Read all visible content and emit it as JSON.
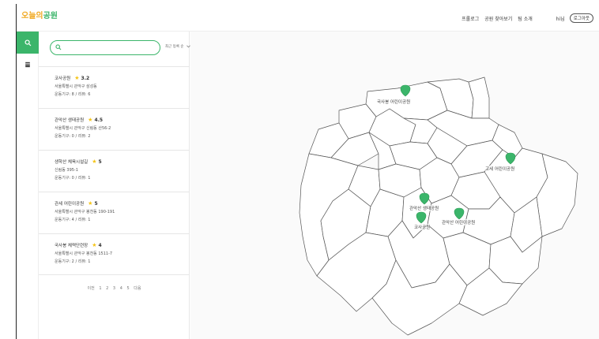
{
  "header": {
    "logo": {
      "part1": "오늘의",
      "part2": "공원"
    },
    "nav": [
      "프롤로그",
      "공원 찾아보기",
      "팀 소개"
    ],
    "user": "hi님",
    "logout": "로그아웃"
  },
  "sidebar": {
    "tabs": [
      {
        "name": "search",
        "icon": "search-icon",
        "active": true
      },
      {
        "name": "bookmark",
        "icon": "book-icon",
        "active": false
      }
    ]
  },
  "search": {
    "placeholder": "",
    "value": ""
  },
  "sort": {
    "label": "최근 등록 순"
  },
  "parks": [
    {
      "name": "코사공원",
      "rating": "3.2",
      "address": "서울특별시 관악구 삼성동",
      "stats": "운동기구: 8 / 리뷰: 6"
    },
    {
      "name": "관악산 생태공원",
      "rating": "4.5",
      "address": "서울특별시 관악구 신림동 산56-2",
      "stats": "운동기구: 0 / 리뷰: 2"
    },
    {
      "name": "생학산 체육시설길",
      "rating": "5",
      "address": "신림동 395-1",
      "stats": "운동기구: 0 / 리뷰: 1"
    },
    {
      "name": "관세 어린이공원",
      "rating": "5",
      "address": "서울특별시 관악구 봉천동 190-191",
      "stats": "운동기구: 4 / 리뷰: 1"
    },
    {
      "name": "국사봉 체력단련장",
      "rating": "4",
      "address": "서울특별시 관악구 봉천동 1511-7",
      "stats": "운동기구: 2 / 리뷰: 1"
    }
  ],
  "pagination": {
    "prev": "이전",
    "pages": [
      "1",
      "2",
      "3",
      "4",
      "5"
    ],
    "next": "다음"
  },
  "map": {
    "accent": "#3bb56a",
    "markers": [
      {
        "label": "국사봉 어린이공원"
      },
      {
        "label": "고세 어린이공원"
      },
      {
        "label": "관악산 생태공원"
      },
      {
        "label": "코사공원"
      },
      {
        "label": "관악산 어린이공원"
      }
    ]
  }
}
